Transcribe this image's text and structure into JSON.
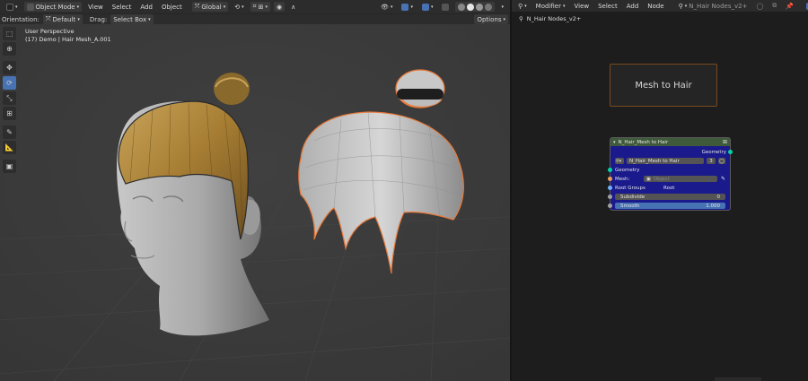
{
  "viewport": {
    "header": {
      "mode": "Object Mode",
      "menus": [
        "View",
        "Select",
        "Add",
        "Object"
      ],
      "transform_orientation": "Global"
    },
    "subheader": {
      "orientation_label": "Orientation:",
      "orientation_value": "Default",
      "drag_label": "Drag:",
      "drag_value": "Select Box",
      "options": "Options"
    },
    "info": {
      "perspective": "User Perspective",
      "object": "(17) Demo | Hair Mesh_A.001"
    },
    "tools": [
      "select-box",
      "cursor",
      "move",
      "rotate",
      "scale",
      "transform",
      "annotate",
      "measure",
      "add-cube"
    ],
    "active_tool": "rotate"
  },
  "node_editor": {
    "header": {
      "editor_type": "Modifier",
      "menus": [
        "View",
        "Select",
        "Add",
        "Node"
      ],
      "node_tree": "N_Hair Nodes_v2+"
    },
    "breadcrumb": "N_Hair Nodes_v2+",
    "frame_label": "Mesh to Hair",
    "group_node": {
      "title": "N_Hair_Mesh to Hair",
      "output": "Geometry",
      "datablock": "N_Hair_Mesh to Hair",
      "users": "3",
      "inputs": {
        "geometry": "Geometry",
        "mesh_label": "Mesh:",
        "mesh_placeholder": "Object",
        "root_groups_label": "Root Groups",
        "root_groups_value": "Root",
        "subdivide_label": "Subdivide",
        "subdivide_value": "0",
        "smooth_label": "Smooth",
        "smooth_value": "1.000"
      }
    }
  },
  "colors": {
    "accent": "#4772b3",
    "selection_outline": "#e8793a",
    "node_body": "#1a1a8c",
    "node_header": "#3f5a3a",
    "frame_border": "#7a4a1e"
  }
}
